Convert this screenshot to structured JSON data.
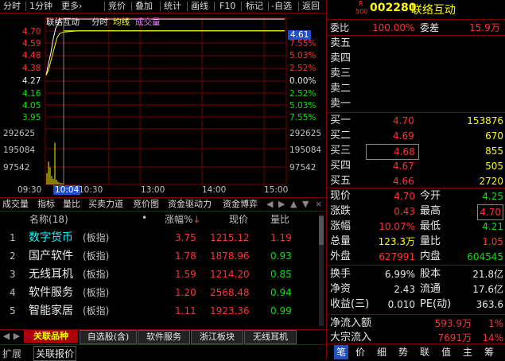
{
  "toolbar": {
    "items": [
      "分时",
      "1分钟",
      "更多",
      "竞价",
      "叠加",
      "统计",
      "画线",
      "F10",
      "标记",
      "-自选",
      "返回"
    ]
  },
  "chart": {
    "stock_name": "联络互动",
    "mode": "分时",
    "avg_label": "均线",
    "vol_label": "成交量",
    "current_tag": "4.61",
    "price_ticks": [
      "4.70",
      "4.59",
      "4.48",
      "4.38",
      "4.27",
      "4.16",
      "4.05",
      "3.95"
    ],
    "pct_ticks": [
      "10.07%",
      "7.55%",
      "5.03%",
      "2.52%",
      "0.00%",
      "2.52%",
      "5.03%",
      "7.55%"
    ],
    "vol_ticks_left": [
      "292625",
      "195084",
      "97542"
    ],
    "vol_ticks_right": [
      "292625",
      "195084",
      "97542"
    ],
    "time_ticks": [
      "09:30",
      "10:04",
      "10:30",
      "13:00",
      "14:00",
      "15:00"
    ],
    "cursor_time": "10:04"
  },
  "chart_data": {
    "type": "line",
    "title": "联络互动 分时",
    "x": [
      "09:30",
      "09:35",
      "09:40",
      "09:45",
      "09:50",
      "09:55",
      "10:00",
      "10:04",
      "10:30",
      "13:00",
      "14:00",
      "15:00"
    ],
    "series": [
      {
        "name": "价格",
        "values": [
          4.27,
          4.36,
          4.44,
          4.55,
          4.63,
          4.65,
          4.7,
          4.7,
          4.7,
          4.7,
          4.7,
          4.7
        ]
      },
      {
        "name": "均线",
        "values": [
          4.27,
          4.31,
          4.38,
          4.45,
          4.52,
          4.56,
          4.59,
          4.6,
          4.61,
          4.61,
          4.61,
          4.61
        ]
      }
    ],
    "ylim": [
      3.95,
      4.7
    ],
    "volume_ylim": [
      0,
      292625
    ]
  },
  "tabs": [
    "成交量",
    "指标",
    "量比",
    "买卖力道",
    "竞价图",
    "资金驱动力",
    "资金博弈"
  ],
  "list": {
    "headers": {
      "name": "名称",
      "count": "(18)",
      "dot": "•",
      "pct": "涨幅%",
      "price": "现价",
      "ratio": "量比"
    },
    "rows": [
      {
        "idx": "1",
        "name": "数字货币",
        "tag": "(板指)",
        "pct": "3.75",
        "price": "1215.12",
        "ratio": "1.19"
      },
      {
        "idx": "2",
        "name": "国产软件",
        "tag": "(板指)",
        "pct": "1.78",
        "price": "1878.96",
        "ratio": "0.93"
      },
      {
        "idx": "3",
        "name": "无线耳机",
        "tag": "(板指)",
        "pct": "1.59",
        "price": "1214.20",
        "ratio": "0.85"
      },
      {
        "idx": "4",
        "name": "软件服务",
        "tag": "(板指)",
        "pct": "1.20",
        "price": "2568.48",
        "ratio": "0.94"
      },
      {
        "idx": "5",
        "name": "智能家居",
        "tag": "(板指)",
        "pct": "1.11",
        "price": "1923.36",
        "ratio": "0.99"
      }
    ]
  },
  "bottom_tabs": [
    "关联品种",
    "自选股(含)",
    "软件服务",
    "浙江板块",
    "无线耳机"
  ],
  "footer": {
    "expand": "扩展",
    "related": "关联报价"
  },
  "quote": {
    "badge_top": "R",
    "badge_bottom": "500",
    "code": "002280",
    "name": "联络互动",
    "weibi_label": "委比",
    "weibi": "100.00%",
    "weicha_label": "委差",
    "weicha": "15.9万",
    "sells": [
      "卖五",
      "卖四",
      "卖三",
      "卖二",
      "卖一"
    ],
    "buys": [
      {
        "label": "买一",
        "price": "4.70",
        "vol": "153876"
      },
      {
        "label": "买二",
        "price": "4.69",
        "vol": "670"
      },
      {
        "label": "买三",
        "price": "4.68",
        "vol": "855"
      },
      {
        "label": "买四",
        "price": "4.67",
        "vol": "505"
      },
      {
        "label": "买五",
        "price": "4.66",
        "vol": "2720"
      }
    ],
    "stats": [
      {
        "l1": "现价",
        "v1": "4.70",
        "l2": "今开",
        "v2": "4.25"
      },
      {
        "l1": "涨跌",
        "v1": "0.43",
        "l2": "最高",
        "v2": "4.70"
      },
      {
        "l1": "涨幅",
        "v1": "10.07%",
        "l2": "最低",
        "v2": "4.21"
      },
      {
        "l1": "总量",
        "v1": "123.3万",
        "l2": "量比",
        "v2": "1.05"
      },
      {
        "l1": "外盘",
        "v1": "627991",
        "l2": "内盘",
        "v2": "604545"
      }
    ],
    "stats2": [
      {
        "l1": "换手",
        "v1": "6.99%",
        "l2": "股本",
        "v2": "21.8亿"
      },
      {
        "l1": "净资",
        "v1": "2.43",
        "l2": "流通",
        "v2": "17.6亿"
      },
      {
        "l1": "收益(三)",
        "v1": "0.010",
        "l2": "PE(动)",
        "v2": "363.6"
      }
    ],
    "flow": [
      {
        "label": "净流入额",
        "value": "593.9万",
        "pct": "1%"
      },
      {
        "label": "大宗流入",
        "value": "7691万",
        "pct": "14%"
      }
    ],
    "bottom_tabs": [
      "笔",
      "价",
      "细",
      "势",
      "联",
      "值",
      "主",
      "筹"
    ]
  }
}
